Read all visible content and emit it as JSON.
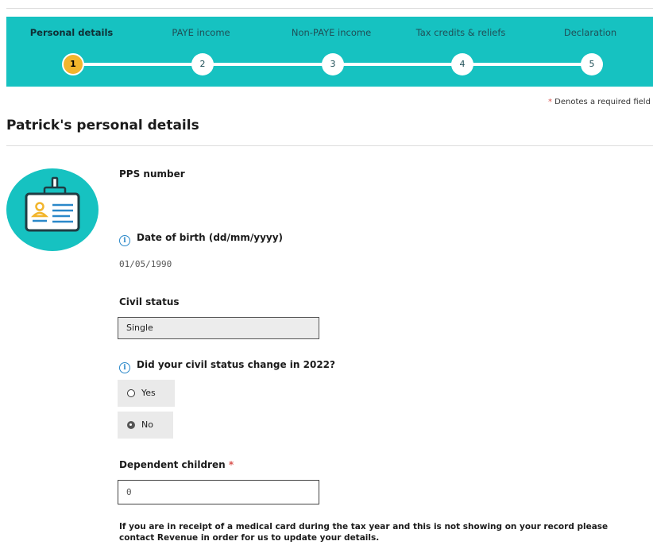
{
  "stepper": {
    "steps": [
      {
        "label": "Personal details",
        "number": "1",
        "active": true
      },
      {
        "label": "PAYE income",
        "number": "2",
        "active": false
      },
      {
        "label": "Non-PAYE income",
        "number": "3",
        "active": false
      },
      {
        "label": "Tax credits & reliefs",
        "number": "4",
        "active": false
      },
      {
        "label": "Declaration",
        "number": "5",
        "active": false
      }
    ],
    "color": "#16c2c1",
    "active_color": "#f2b52c"
  },
  "required_note": {
    "star": "*",
    "text": " Denotes a required field"
  },
  "page": {
    "title": "Patrick's personal details"
  },
  "avatar": {
    "icon": "id-badge-icon"
  },
  "form": {
    "pps_label": "PPS number",
    "dob_label": "Date of birth (dd/mm/yyyy)",
    "dob_value": "01/05/1990",
    "civil_status_label": "Civil status",
    "civil_status_value": "Single",
    "civil_change_label": "Did your civil status change in 2022?",
    "options": {
      "yes": "Yes",
      "no": "No"
    },
    "selected_option": "No",
    "dependent_label": "Dependent children",
    "dependent_required": "*",
    "dependent_value": "0",
    "info_glyph": "i"
  },
  "notice": "If you are in receipt of a medical card during the tax year and this is not showing on your record please contact Revenue in order for us to update your details."
}
